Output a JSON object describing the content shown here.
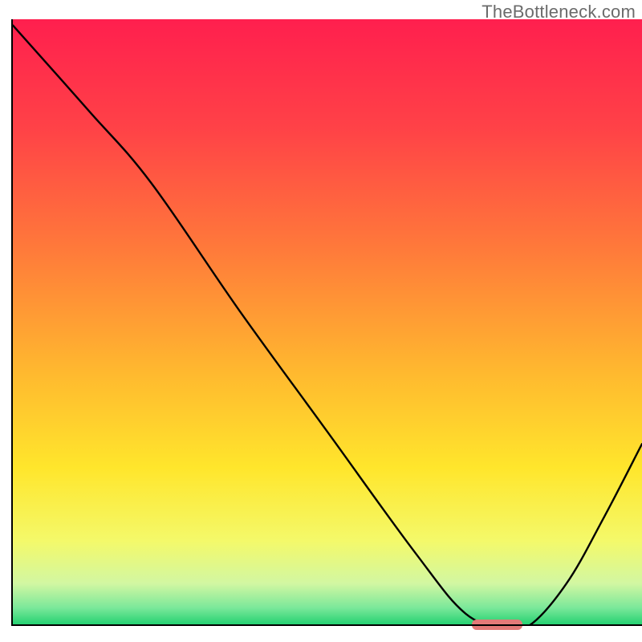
{
  "watermark": {
    "text": "TheBottleneck.com"
  },
  "chart_data": {
    "type": "line",
    "title": "",
    "xlabel": "",
    "ylabel": "",
    "xlim": [
      0,
      100
    ],
    "ylim": [
      0,
      100
    ],
    "x": [
      0,
      12,
      22,
      36,
      50,
      64,
      72,
      78,
      82,
      88,
      94,
      100
    ],
    "values": [
      99,
      85,
      73,
      52,
      32,
      12,
      2,
      0,
      0,
      7,
      18,
      30
    ],
    "optimal_range_x": [
      73,
      81
    ],
    "gradient_stops": [
      {
        "offset": 0,
        "color": "#ff1f4e"
      },
      {
        "offset": 18,
        "color": "#ff4247"
      },
      {
        "offset": 38,
        "color": "#ff7a3a"
      },
      {
        "offset": 58,
        "color": "#ffb82f"
      },
      {
        "offset": 74,
        "color": "#ffe62c"
      },
      {
        "offset": 86,
        "color": "#f4f96a"
      },
      {
        "offset": 93,
        "color": "#d2f7a2"
      },
      {
        "offset": 97,
        "color": "#7be89a"
      },
      {
        "offset": 100,
        "color": "#1ecf6e"
      }
    ]
  }
}
